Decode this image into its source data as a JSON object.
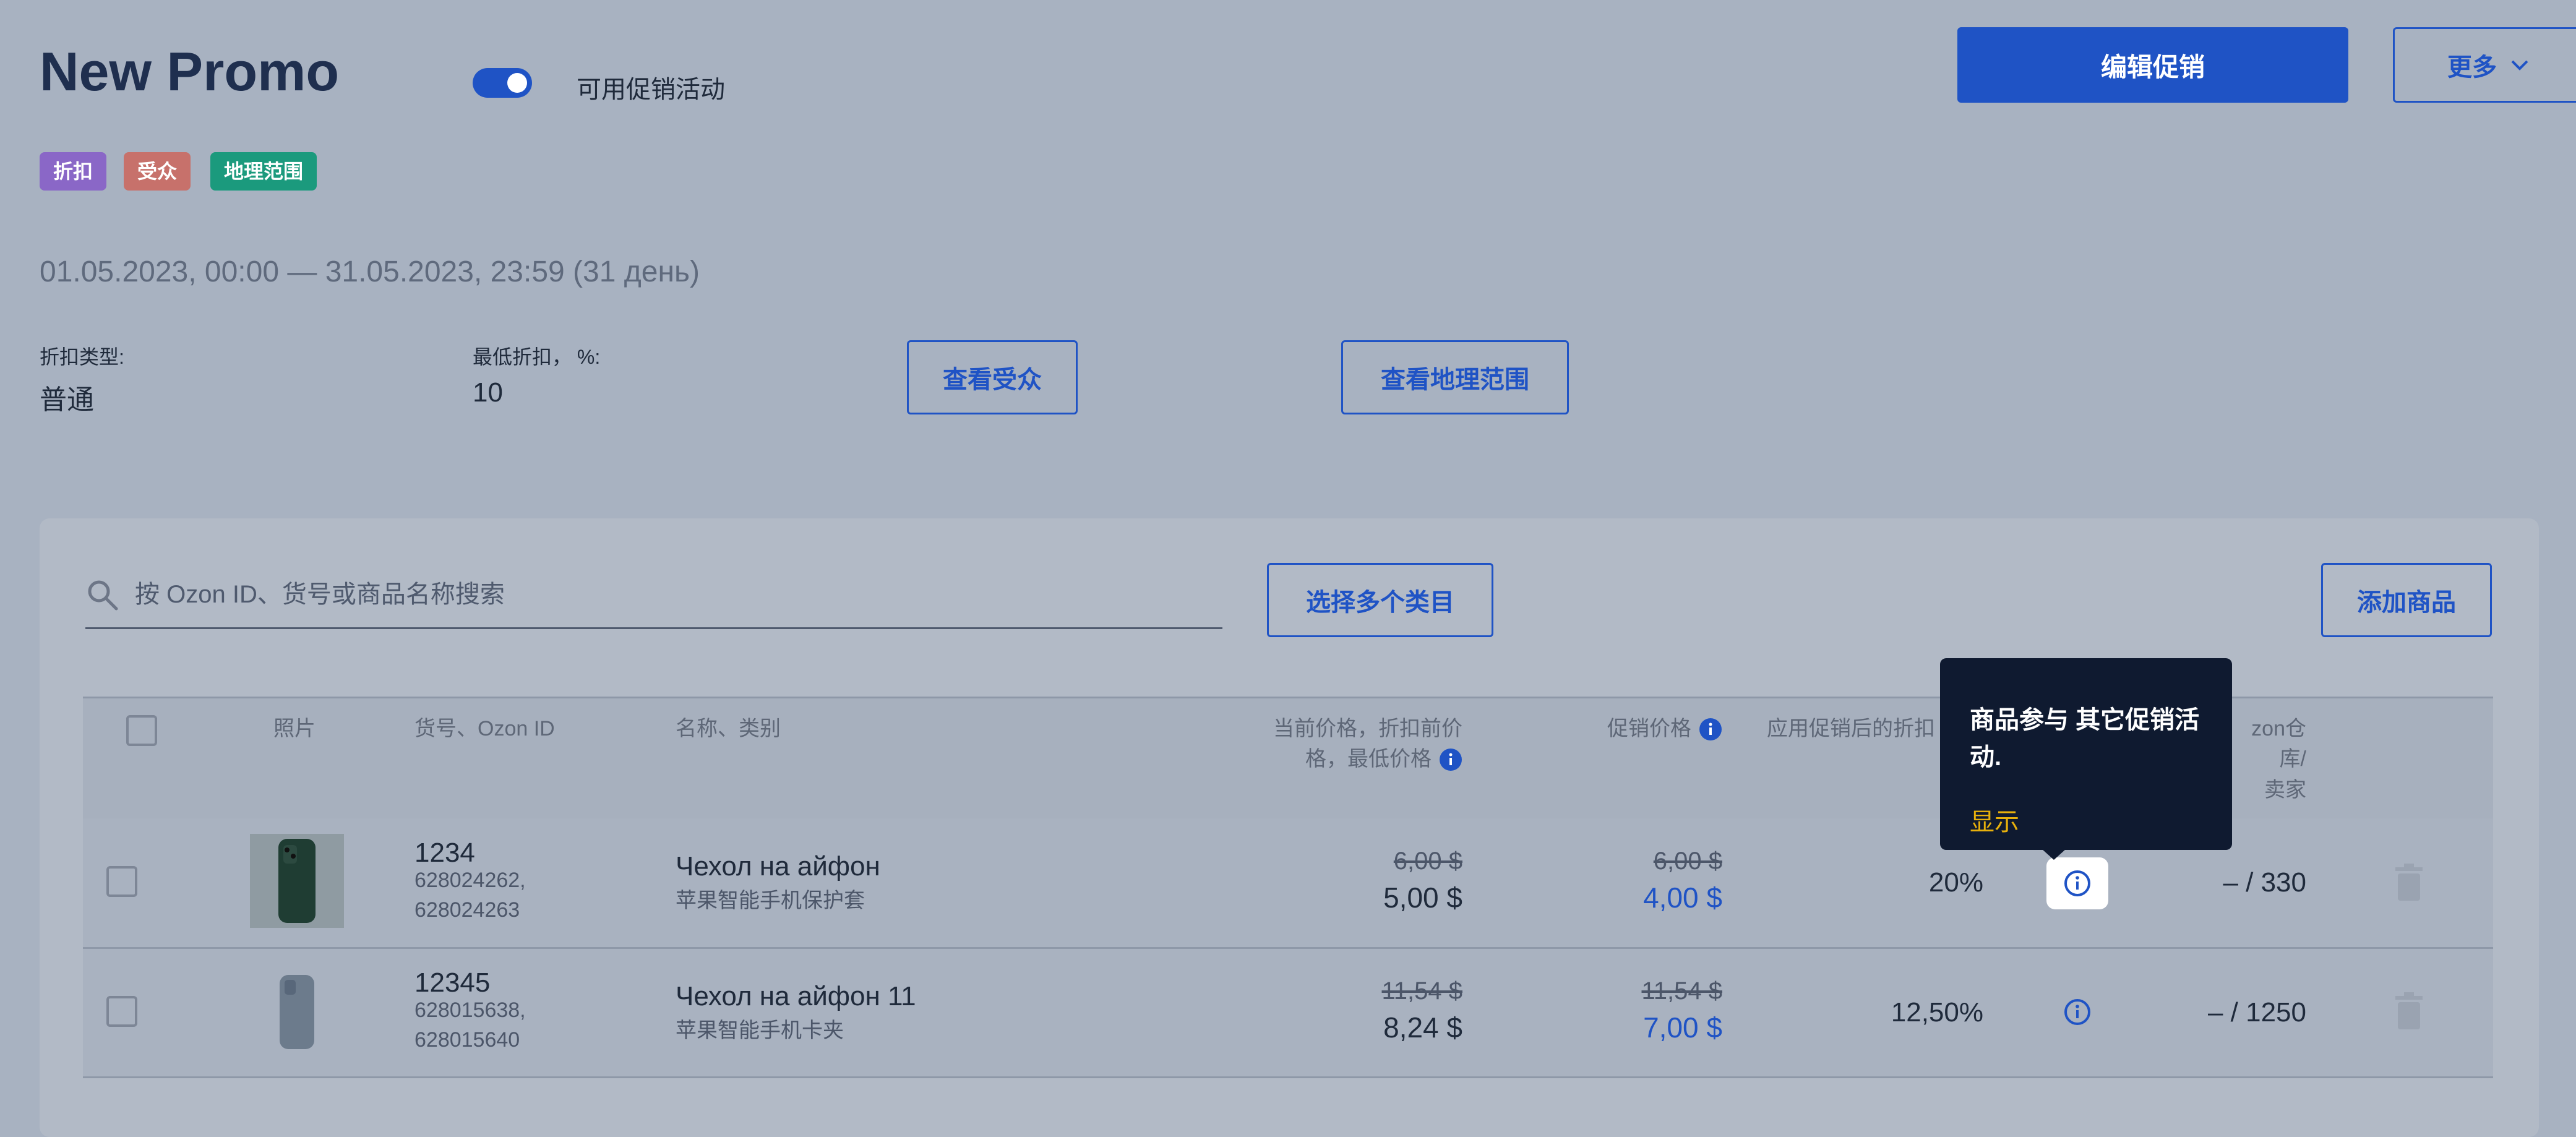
{
  "header": {
    "title": "New Promo",
    "toggle_on": true,
    "toggle_label": "可用促销活动",
    "edit_button": "编辑促销",
    "more_button": "更多"
  },
  "tags": [
    {
      "label": "折扣",
      "color": "#8a67c7"
    },
    {
      "label": "受众",
      "color": "#c7716b"
    },
    {
      "label": "地理范围",
      "color": "#1b9a7d"
    }
  ],
  "date_range": "01.05.2023, 00:00 — 31.05.2023, 23:59 (31 день)",
  "details": {
    "discount_type_label": "折扣类型:",
    "discount_type_value": "普通",
    "min_discount_label": "最低折扣， %:",
    "min_discount_value": "10",
    "view_audience_button": "查看受众",
    "view_geo_button": "查看地理范围"
  },
  "toolbar": {
    "search_placeholder": "按 Ozon ID、货号或商品名称搜索",
    "select_categories_button": "选择多个类目",
    "add_product_button": "添加商品"
  },
  "table": {
    "columns": {
      "photo": "照片",
      "sku": "货号、Ozon ID",
      "name": "名称、类别",
      "current_price_l1": "当前价格，折扣前价",
      "current_price_l2": "格，最低价格",
      "promo_price": "促销价格",
      "discount_after": "应用促销后的折扣",
      "stock_l1": "zon仓库/",
      "stock_l2": "卖家"
    },
    "rows": [
      {
        "sku": "1234",
        "ids_line1": "628024262,",
        "ids_line2": "628024263",
        "name": "Чехол на айфон",
        "category": "苹果智能手机保护套",
        "price_old": "6,00 $",
        "price_current": "5,00 $",
        "promo_old": "6,00 $",
        "promo_price": "4,00 $",
        "discount": "20%",
        "stock": "– / 330"
      },
      {
        "sku": "12345",
        "ids_line1": "628015638,",
        "ids_line2": "628015640",
        "name": "Чехол на айфон 11",
        "category": "苹果智能手机卡夹",
        "price_old": "11,54 $",
        "price_current": "8,24 $",
        "promo_old": "11,54 $",
        "promo_price": "7,00 $",
        "discount": "12,50%",
        "stock": "– / 1250"
      }
    ]
  },
  "tooltip": {
    "text": "商品参与 其它促销活动.",
    "link": "显示"
  },
  "colors": {
    "accent": "#1f53c5",
    "tooltip_bg": "#0f1a30",
    "tooltip_link": "#e8b10c"
  },
  "icons": {
    "search": "search-icon",
    "info": "info-icon",
    "chevron": "chevron-down-icon",
    "trash": "trash-icon"
  }
}
